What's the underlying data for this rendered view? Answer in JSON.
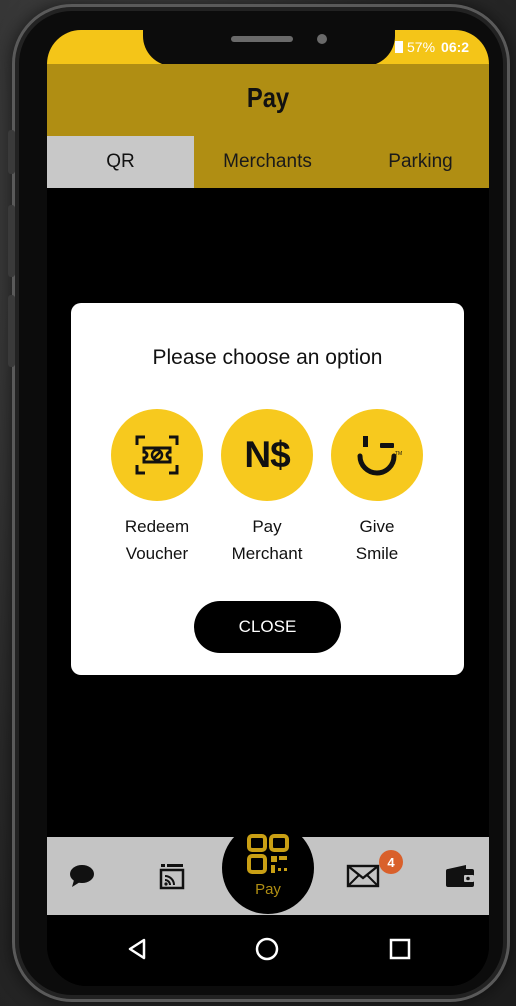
{
  "status_bar": {
    "battery": "57%",
    "time": "06:2"
  },
  "app_bar": {
    "title": "Pay"
  },
  "tabs": [
    {
      "label": "QR",
      "active": true
    },
    {
      "label": "Merchants",
      "active": false
    },
    {
      "label": "Parking",
      "active": false
    }
  ],
  "dialog": {
    "title": "Please choose an option",
    "options": [
      {
        "label": "Redeem\nVoucher",
        "icon": "voucher-scan-icon"
      },
      {
        "label": "Pay\nMerchant",
        "icon": "ns-currency-icon",
        "icon_text": "N$"
      },
      {
        "label": "Give\nSmile",
        "icon": "smile-wink-icon"
      }
    ],
    "close_label": "CLOSE"
  },
  "bottom_nav": {
    "items": [
      {
        "icon": "chat-icon"
      },
      {
        "icon": "cast-icon"
      },
      {
        "icon": "qr-code-icon",
        "label": "Pay"
      },
      {
        "icon": "mail-icon",
        "badge": "4"
      },
      {
        "icon": "wallet-icon"
      }
    ]
  },
  "system_nav": {
    "buttons": [
      "back-icon",
      "home-icon",
      "recents-icon"
    ]
  },
  "colors": {
    "accent": "#f4c518",
    "app_bar": "#b08e13",
    "badge": "#d9602b",
    "tab_active": "#c8c8c8"
  }
}
